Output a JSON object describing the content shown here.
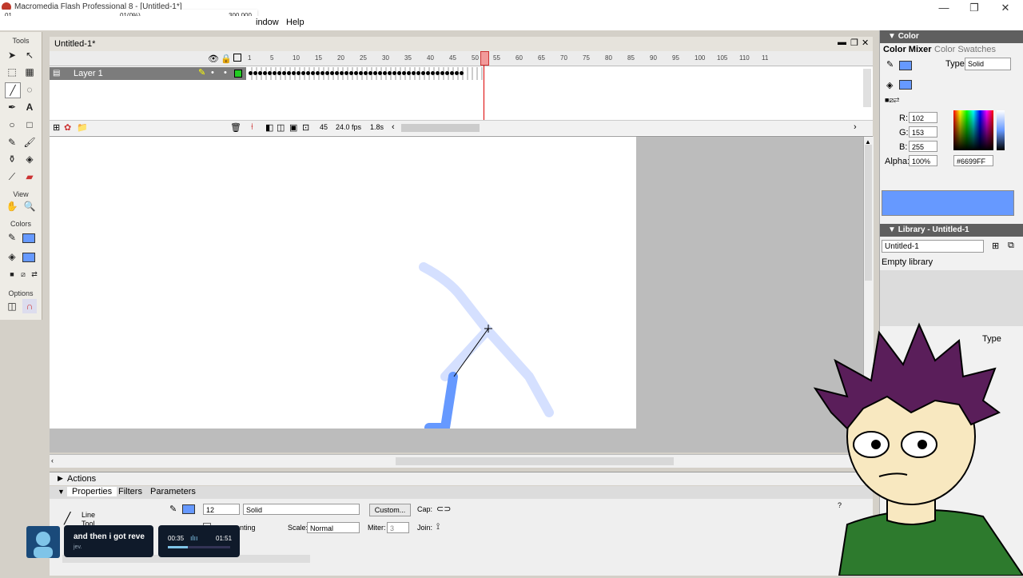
{
  "window": {
    "title": "Macromedia Flash Professional 8 - [Untitled-1*]"
  },
  "overlay": {
    "left_label": "01",
    "percent": "01(0%)",
    "right_label": "300,000"
  },
  "menu": {
    "items": [
      "indow",
      "Help"
    ]
  },
  "tools": {
    "header": "Tools",
    "view_header": "View",
    "colors_header": "Colors",
    "options_header": "Options"
  },
  "document": {
    "tab": "Untitled-1*"
  },
  "timeline": {
    "layer_name": "Layer 1",
    "frame_numbers": [
      "1",
      "5",
      "10",
      "15",
      "20",
      "25",
      "30",
      "35",
      "40",
      "45",
      "50",
      "55",
      "60",
      "65",
      "70",
      "75",
      "80",
      "85",
      "90",
      "95",
      "100",
      "105",
      "110",
      "11"
    ],
    "current_frame": "45",
    "fps": "24.0 fps",
    "elapsed": "1.8s"
  },
  "panels": {
    "actions": "Actions"
  },
  "properties": {
    "tabs": [
      "Properties",
      "Filters",
      "Parameters"
    ],
    "tool_name": "Line",
    "tool_sub": "Tool",
    "stroke_height": "12",
    "stroke_style": "Solid",
    "custom_label": "Custom...",
    "cap_label": "Cap:",
    "scale_label": "Scale:",
    "scale_value": "Normal",
    "miter_label": "Miter:",
    "miter_value": "3",
    "join_label": "Join:",
    "hinting_label": "nting"
  },
  "color_panel": {
    "header": "Color",
    "tab_mixer": "Color Mixer",
    "tab_swatches": "Color Swatches",
    "type_label": "Type:",
    "type_value": "Solid",
    "r_label": "R:",
    "r_value": "102",
    "g_label": "G:",
    "g_value": "153",
    "b_label": "B:",
    "b_value": "255",
    "alpha_label": "Alpha:",
    "alpha_value": "100%",
    "hex_value": "#6699FF",
    "selected_color": "#6699ff"
  },
  "library": {
    "header": "Library - Untitled-1",
    "doc": "Untitled-1",
    "empty_text": "Empty library",
    "type_col": "Type"
  },
  "media": {
    "title": "and then i got reve",
    "subtitle": "jev.",
    "current_time": "00:35",
    "total_time": "01:51",
    "progress": 0.32
  }
}
